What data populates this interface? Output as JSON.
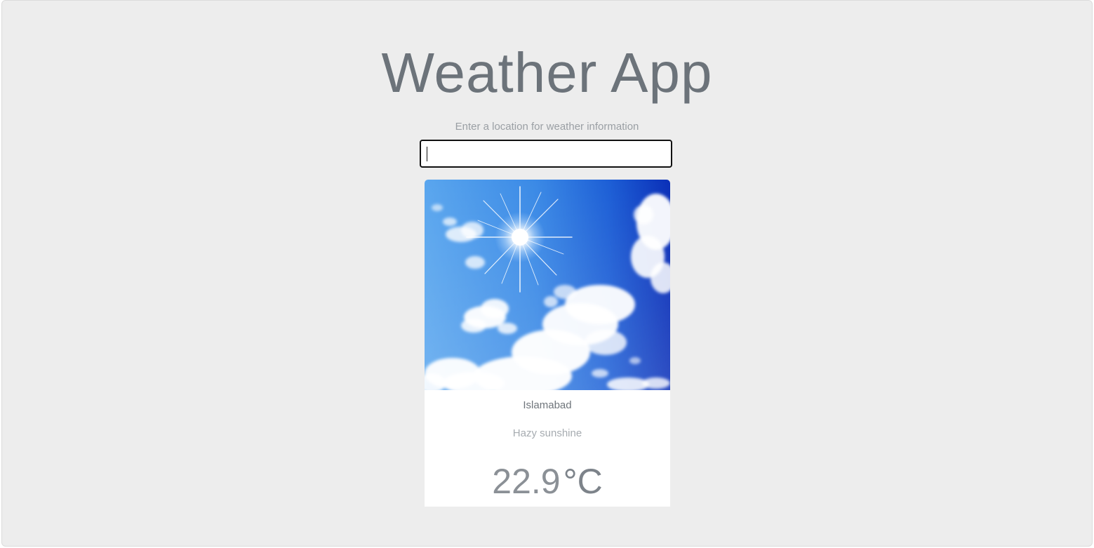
{
  "header": {
    "title": "Weather App"
  },
  "search": {
    "label": "Enter a location for weather information",
    "value": "",
    "placeholder": ""
  },
  "weather": {
    "image_icon": "sunny-sky-image",
    "city": "Islamabad",
    "condition": "Hazy sunshine",
    "temperature": "22.9",
    "unit": "°C"
  },
  "colors": {
    "background": "#ededed",
    "card": "#ffffff",
    "title": "#6c737a",
    "sky_top": "#0a2fb8",
    "sky_light": "#5aa6ee"
  }
}
